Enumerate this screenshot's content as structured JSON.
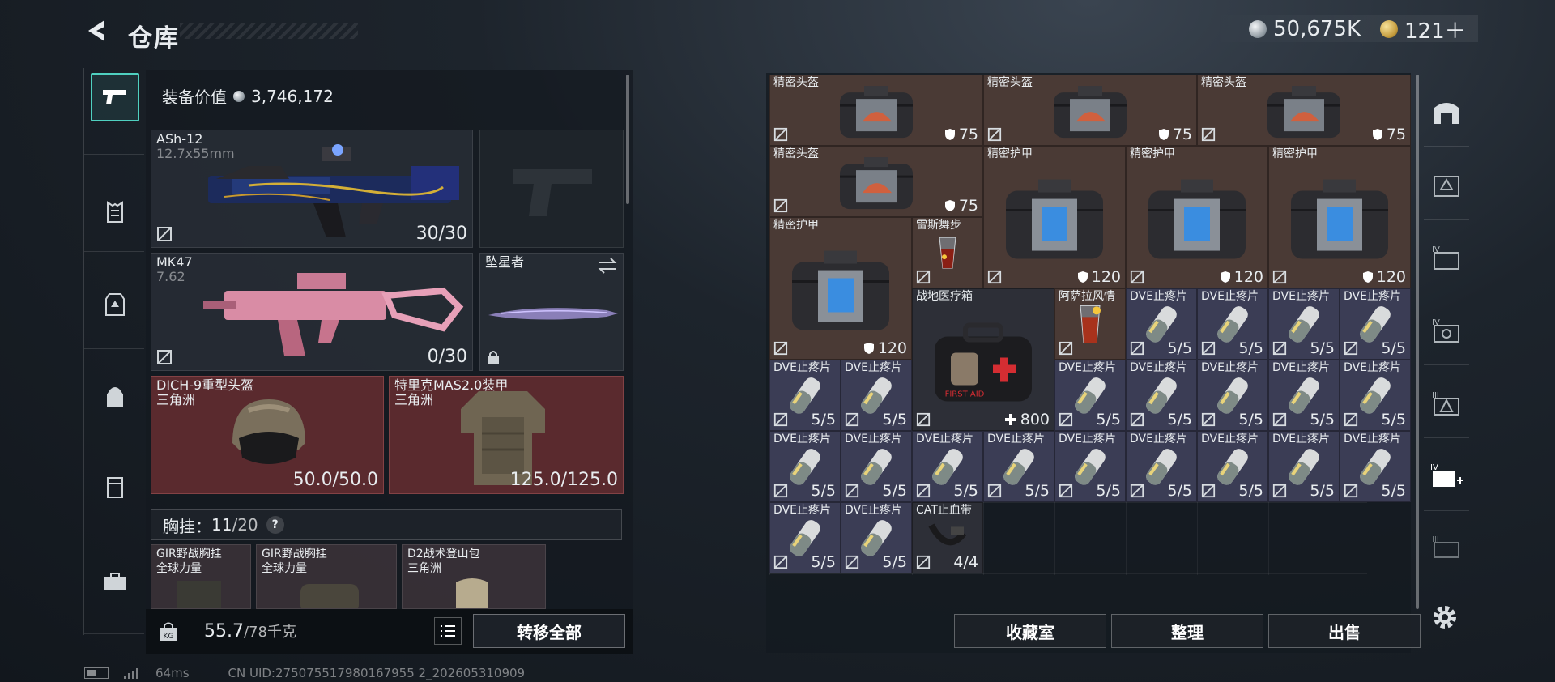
{
  "header": {
    "title": "仓库",
    "currency_silver": "50,675K",
    "currency_gold": "121＋"
  },
  "loadout": {
    "equipment_value_label": "装备价值",
    "equipment_value": "3,746,172",
    "primary": {
      "name": "ASh-12",
      "ammo": "12.7x55mm",
      "count": "30/30"
    },
    "secondary": {
      "name": "MK47",
      "ammo": "7.62",
      "count": "0/30"
    },
    "melee": {
      "name": "坠星者"
    },
    "helmet": {
      "name": "DICH-9重型头盔",
      "faction": "三角洲",
      "durability": "50.0/50.0"
    },
    "armor": {
      "name": "特里克MAS2.0装甲",
      "faction": "三角洲",
      "durability": "125.0/125.0"
    },
    "rig_label": "胸挂：",
    "rig_used": "11",
    "rig_total": "/20",
    "rig_slots": [
      {
        "name": "GIR野战胸挂",
        "faction": "全球力量"
      },
      {
        "name": "GIR野战胸挂",
        "faction": "全球力量"
      },
      {
        "name": "D2战术登山包",
        "faction": "三角洲"
      }
    ],
    "capacity": "55.7",
    "capacity_max": "/78千克",
    "transfer_all": "转移全部"
  },
  "storage": {
    "items": [
      {
        "name": "精密头盔",
        "value": "75"
      },
      {
        "name": "精密头盔",
        "value": "75"
      },
      {
        "name": "精密头盔",
        "value": "75"
      },
      {
        "name": "精密头盔",
        "value": "75"
      },
      {
        "name": "精密护甲",
        "value": "120"
      },
      {
        "name": "精密护甲",
        "value": "120"
      },
      {
        "name": "精密护甲",
        "value": "120"
      },
      {
        "name": "精密护甲",
        "value": "120"
      },
      {
        "name": "雷斯舞步"
      },
      {
        "name": "战地医疗箱",
        "value": "800"
      },
      {
        "name": "阿萨拉风情"
      },
      {
        "name": "DVE止疼片",
        "value": "5/5"
      },
      {
        "name": "CAT止血带",
        "value": "4/4"
      }
    ],
    "footer": {
      "collection": "收藏室",
      "sort": "整理",
      "sell": "出售"
    }
  },
  "status": {
    "ping": "64ms",
    "uid": "CN UID:275075517980167955 2_202605310909"
  },
  "colors": {
    "accent": "#4fd0c0",
    "brown_cell": "#4a3a35",
    "blue_cell": "#3b3d55",
    "red_slot": "#5a2a2e"
  }
}
